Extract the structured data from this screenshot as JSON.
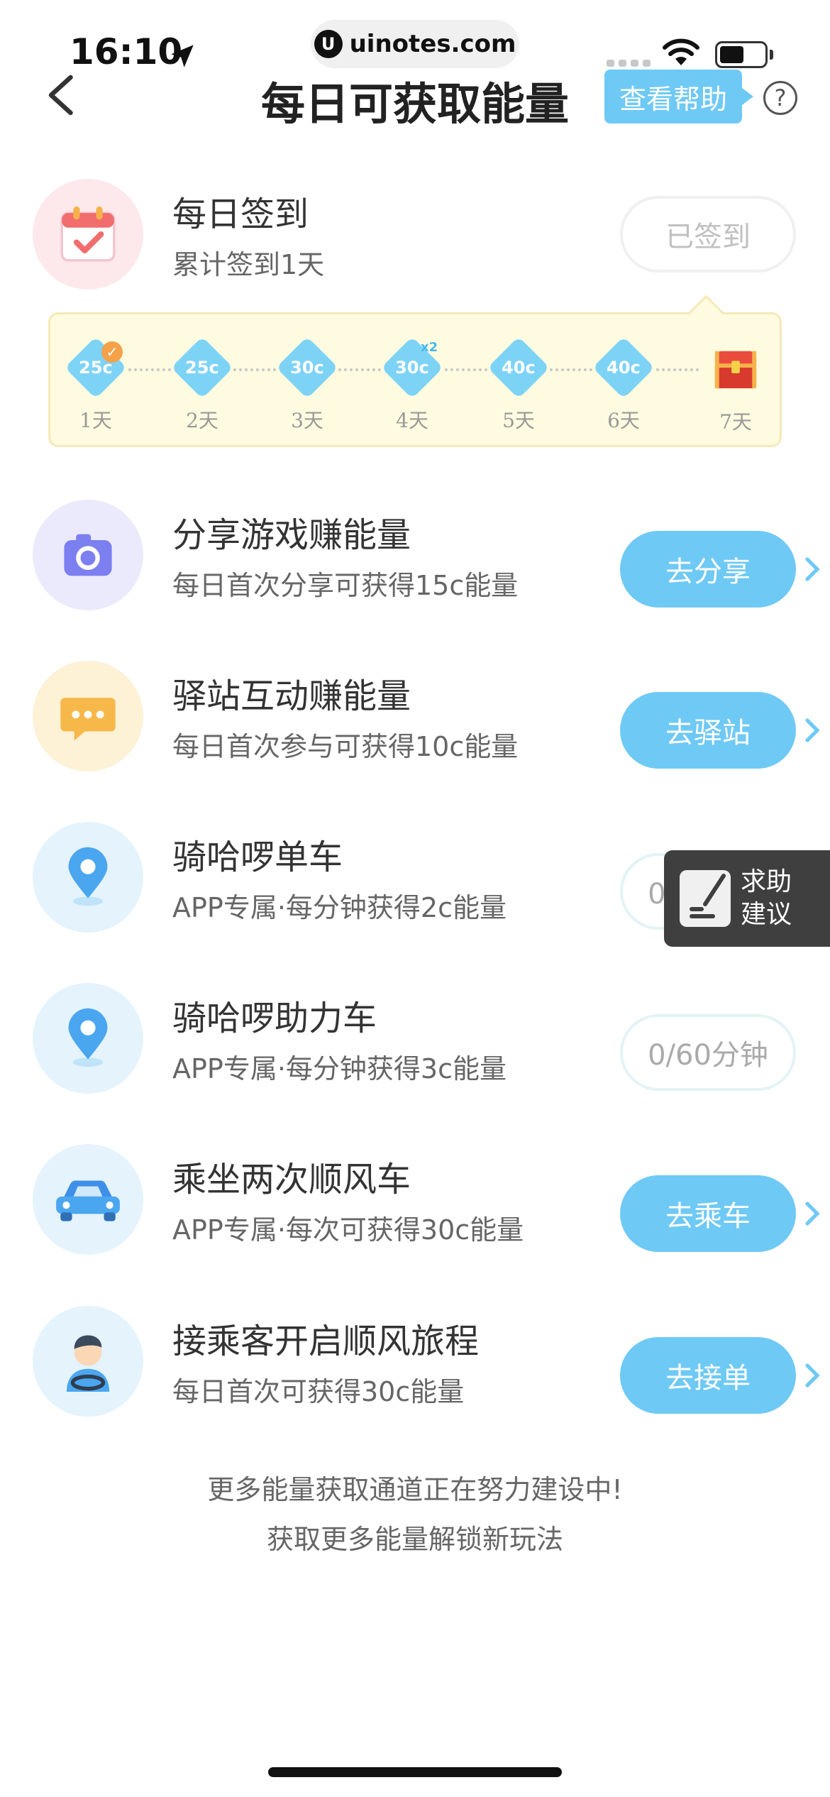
{
  "status_bar": {
    "time": "16:10",
    "watermark": "uinotes.com"
  },
  "nav": {
    "title": "每日可获取能量",
    "help_label": "查看帮助",
    "help_icon_text": "?"
  },
  "checkin": {
    "title": "每日签到",
    "subtitle": "累计签到1天",
    "button_label": "已签到",
    "days": [
      {
        "value": "25c",
        "label": "1天",
        "done": true
      },
      {
        "value": "25c",
        "label": "2天"
      },
      {
        "value": "30c",
        "label": "3天"
      },
      {
        "value": "30c",
        "label": "4天",
        "multiplier": "x2"
      },
      {
        "value": "40c",
        "label": "5天"
      },
      {
        "value": "40c",
        "label": "6天"
      },
      {
        "value": "",
        "label": "7天",
        "reward": "treasure-chest-icon"
      }
    ]
  },
  "tasks": [
    {
      "title": "分享游戏赚能量",
      "subtitle": "每日首次分享可获得15c能量",
      "action": "去分享",
      "icon": "camera-icon"
    },
    {
      "title": "驿站互动赚能量",
      "subtitle": "每日首次参与可获得10c能量",
      "action": "去驿站",
      "icon": "chat-bubble-icon"
    },
    {
      "title": "骑哈啰单车",
      "subtitle": "APP专属·每分钟获得2c能量",
      "action": "0/90分钟",
      "icon": "location-pin-icon"
    },
    {
      "title": "骑哈啰助力车",
      "subtitle": "APP专属·每分钟获得3c能量",
      "action": "0/60分钟",
      "icon": "location-pin-icon"
    },
    {
      "title": "乘坐两次顺风车",
      "subtitle": "APP专属·每次可获得30c能量",
      "action": "去乘车",
      "icon": "car-icon"
    },
    {
      "title": "接乘客开启顺风旅程",
      "subtitle": "每日首次可获得30c能量",
      "action": "去接单",
      "icon": "driver-icon"
    }
  ],
  "feedback": {
    "line1": "求助",
    "line2": "建议"
  },
  "footer": {
    "line1": "更多能量获取通道正在努力建设中!",
    "line2": "获取更多能量解锁新玩法"
  },
  "colors": {
    "accent": "#6ec9f5",
    "gem": "#7dd3f6",
    "strip_bg": "#fffbe0"
  }
}
